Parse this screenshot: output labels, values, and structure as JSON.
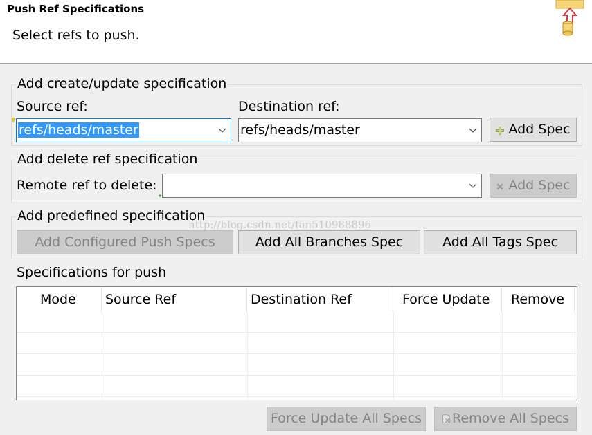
{
  "header": {
    "title": "Push Ref Specifications",
    "description": "Select refs to push."
  },
  "create_update": {
    "title": "Add create/update specification",
    "source_label": "Source ref:",
    "source_value": "refs/heads/master",
    "destination_label": "Destination ref:",
    "destination_value": "refs/heads/master",
    "add_spec_label": "Add Spec"
  },
  "delete_ref": {
    "title": "Add delete ref specification",
    "remote_label": "Remote ref to delete:",
    "remote_value": "",
    "add_spec_label": "Add Spec"
  },
  "predefined": {
    "title": "Add predefined specification",
    "configured_push_label": "Add Configured Push Specs",
    "all_branches_label": "Add All Branches Spec",
    "all_tags_label": "Add All Tags Spec"
  },
  "watermark": "http://blog.csdn.net/fan510988896",
  "specs_table": {
    "title": "Specifications for push",
    "columns": [
      "Mode",
      "Source Ref",
      "Destination Ref",
      "Force Update",
      "Remove"
    ],
    "rows": []
  },
  "footer": {
    "force_update_all_label": "Force Update All Specs",
    "remove_all_label": "Remove All Specs"
  },
  "colors": {
    "selection": "#3399ff",
    "focus_border": "#0078d7",
    "disabled_text": "#838383"
  }
}
